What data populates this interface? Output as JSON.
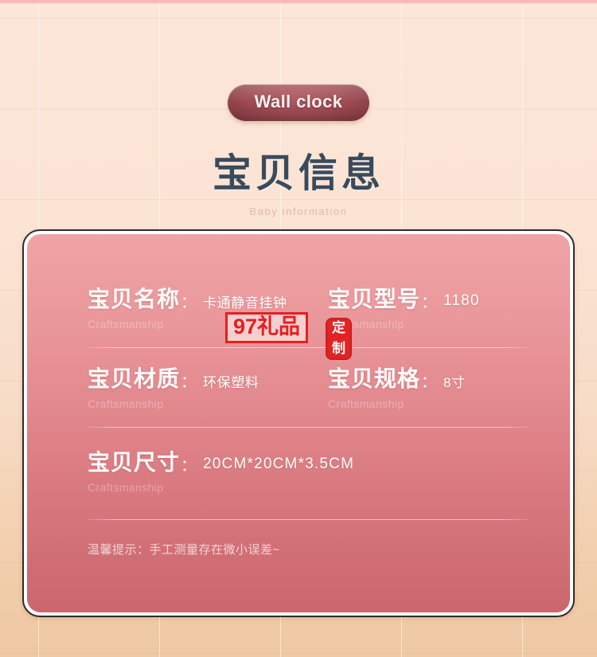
{
  "header": {
    "pill_label": "Wall clock",
    "title": "宝贝信息",
    "subtitle": "Baby information"
  },
  "card": {
    "craftsmanship_caption": "Craftsmanship",
    "rows": [
      {
        "left": {
          "label": "宝贝名称",
          "colon": "：",
          "value": "卡通静音挂钟",
          "caption": "Craftsmanship"
        },
        "right": {
          "label": "宝贝型号",
          "colon": "：",
          "value": "1180",
          "caption": "Craftsmanship"
        }
      },
      {
        "left": {
          "label": "宝贝材质",
          "colon": "：",
          "value": "环保塑料",
          "caption": "Craftsmanship"
        },
        "right": {
          "label": "宝贝规格",
          "colon": "：",
          "value": "8寸",
          "caption": "Craftsmanship"
        }
      },
      {
        "left": {
          "label": "宝贝尺寸",
          "colon": "：",
          "value": "20CM*20CM*3.5CM",
          "caption": "Craftsmanship"
        },
        "right": {
          "label": "",
          "colon": "",
          "value": "",
          "caption": ""
        }
      }
    ],
    "tip": "温馨提示：手工测量存在微小误差~"
  },
  "watermarks": {
    "box_text": "97礼品",
    "seal_text": "定制"
  },
  "colors": {
    "background_top": "#fbe6d8",
    "background_bottom": "#efc8a4",
    "top_strip": "#f6b3b6",
    "pill": "#a24d55",
    "title": "#3b4a5b",
    "subtitle": "#e2b7b0",
    "card_top": "#f0a3a6",
    "card_bottom": "#cb666e",
    "card_border": "#2c2c2c",
    "watermark_red": "#e71e1e"
  }
}
